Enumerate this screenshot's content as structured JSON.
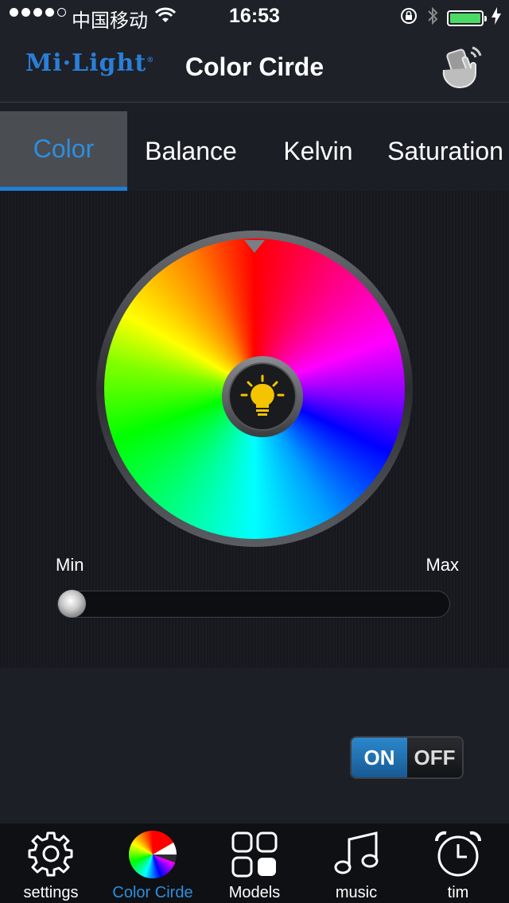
{
  "status_bar": {
    "carrier": "中国移动",
    "time": "16:53"
  },
  "header": {
    "logo": "Mi·Light",
    "logo_mark": "®",
    "title": "Color Cirde"
  },
  "tabs": [
    {
      "label": "Color",
      "active": true
    },
    {
      "label": "Balance"
    },
    {
      "label": "Kelvin"
    },
    {
      "label": "Saturation"
    }
  ],
  "slider": {
    "min_label": "Min",
    "max_label": "Max",
    "value_fraction": 0.0
  },
  "power_toggle": {
    "on_label": "ON",
    "off_label": "OFF",
    "state": "on"
  },
  "tab_bar": [
    {
      "label": "settings",
      "icon": "gear-icon"
    },
    {
      "label": "Color Cirde",
      "icon": "color-wheel-icon",
      "active": true
    },
    {
      "label": "Models",
      "icon": "grid-icon"
    },
    {
      "label": "music",
      "icon": "music-note-icon"
    },
    {
      "label": "tim",
      "icon": "alarm-clock-icon"
    }
  ],
  "colors": {
    "accent": "#2c8fe0",
    "battery": "#4cd964",
    "on_button": "#2c87cc"
  }
}
